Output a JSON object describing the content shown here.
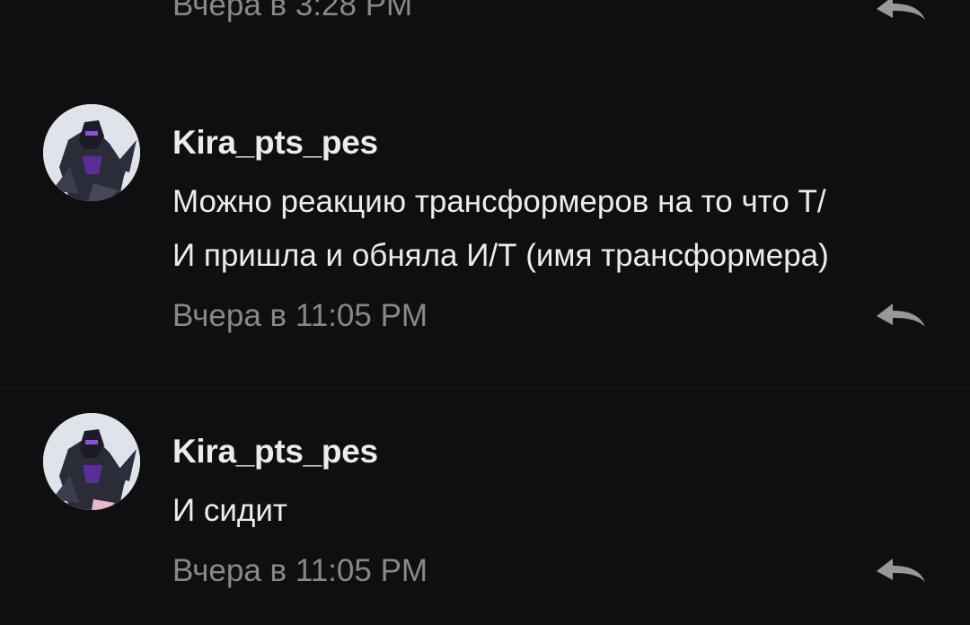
{
  "colors": {
    "background": "#0f0e10",
    "text_primary": "#ecebee",
    "text_secondary": "#8a878b",
    "reply_icon": "#9a979b",
    "avatar_accent": "#6a2fb8"
  },
  "comments": [
    {
      "timestamp": "Вчера в 3:28 PM",
      "reply_icon": "reply-arrow-icon"
    },
    {
      "author": "Kira_pts_pes",
      "avatar_icon": "transformer-avatar",
      "message_lines": [
        "Можно реакцию трансформеров на то что Т/",
        "И пришла и обняла И/Т (имя трансформера)"
      ],
      "timestamp": "Вчера в 11:05 PM",
      "reply_icon": "reply-arrow-icon"
    },
    {
      "author": "Kira_pts_pes",
      "avatar_icon": "transformer-avatar",
      "message_lines": [
        "И сидит"
      ],
      "timestamp": "Вчера в 11:05 PM",
      "reply_icon": "reply-arrow-icon"
    }
  ]
}
